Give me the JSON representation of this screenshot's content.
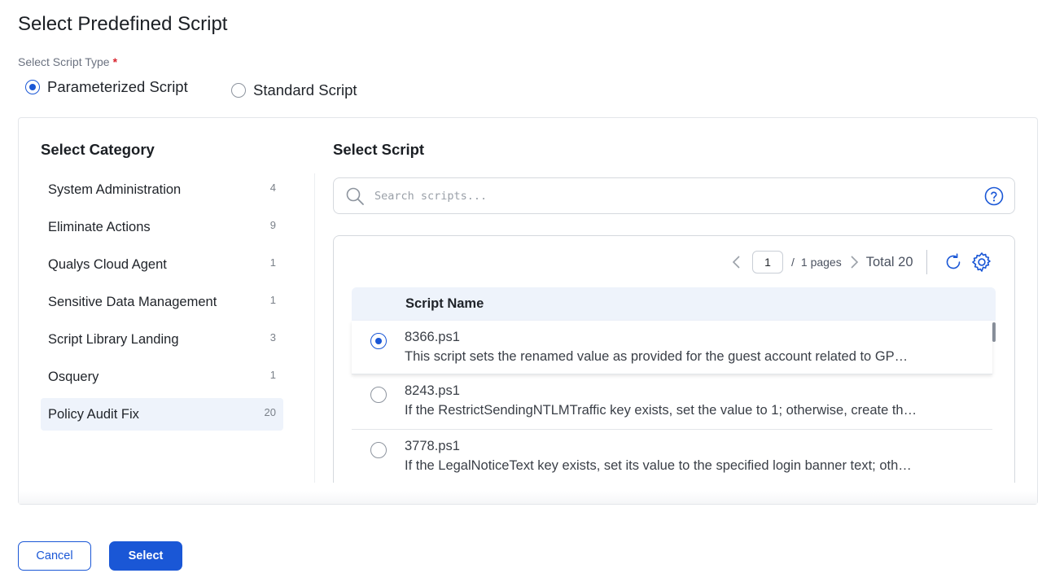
{
  "dialog": {
    "title": "Select Predefined Script"
  },
  "script_type": {
    "label": "Select Script Type",
    "required_mark": "*",
    "options": [
      {
        "label": "Parameterized Script",
        "selected": true
      },
      {
        "label": "Standard Script",
        "selected": false
      }
    ]
  },
  "category": {
    "title": "Select Category",
    "items": [
      {
        "label": "System Administration",
        "count": "4"
      },
      {
        "label": "Eliminate Actions",
        "count": "9"
      },
      {
        "label": "Qualys Cloud Agent",
        "count": "1"
      },
      {
        "label": "Sensitive Data Management",
        "count": "1"
      },
      {
        "label": "Script Library Landing",
        "count": "3"
      },
      {
        "label": "Osquery",
        "count": "1"
      },
      {
        "label": "Policy Audit Fix",
        "count": "20"
      }
    ],
    "active_index": 6
  },
  "script": {
    "title": "Select Script",
    "search": {
      "placeholder": "Search scripts...",
      "value": ""
    },
    "pager": {
      "current_page": "1",
      "separator": "/",
      "pages_label": "1 pages",
      "total_label": "Total 20"
    },
    "table": {
      "column_header": "Script Name",
      "rows": [
        {
          "name": "8366.ps1",
          "description": "This script sets the renamed value as provided for the guest account related to GP…",
          "selected": true
        },
        {
          "name": "8243.ps1",
          "description": "If the RestrictSendingNTLMTraffic key exists, set the value to 1; otherwise, create th…",
          "selected": false
        },
        {
          "name": "3778.ps1",
          "description": "If the LegalNoticeText key exists, set its value to the specified login banner text; oth…",
          "selected": false
        }
      ]
    }
  },
  "footer": {
    "cancel_label": "Cancel",
    "select_label": "Select"
  },
  "colors": {
    "accent": "#1a57d6",
    "required": "#d9252f",
    "active_bg": "#eef3fb"
  },
  "icons": [
    "search-icon",
    "help-icon",
    "chevron-left-icon",
    "chevron-right-icon",
    "refresh-icon",
    "gear-icon",
    "mouse-cursor-icon"
  ]
}
